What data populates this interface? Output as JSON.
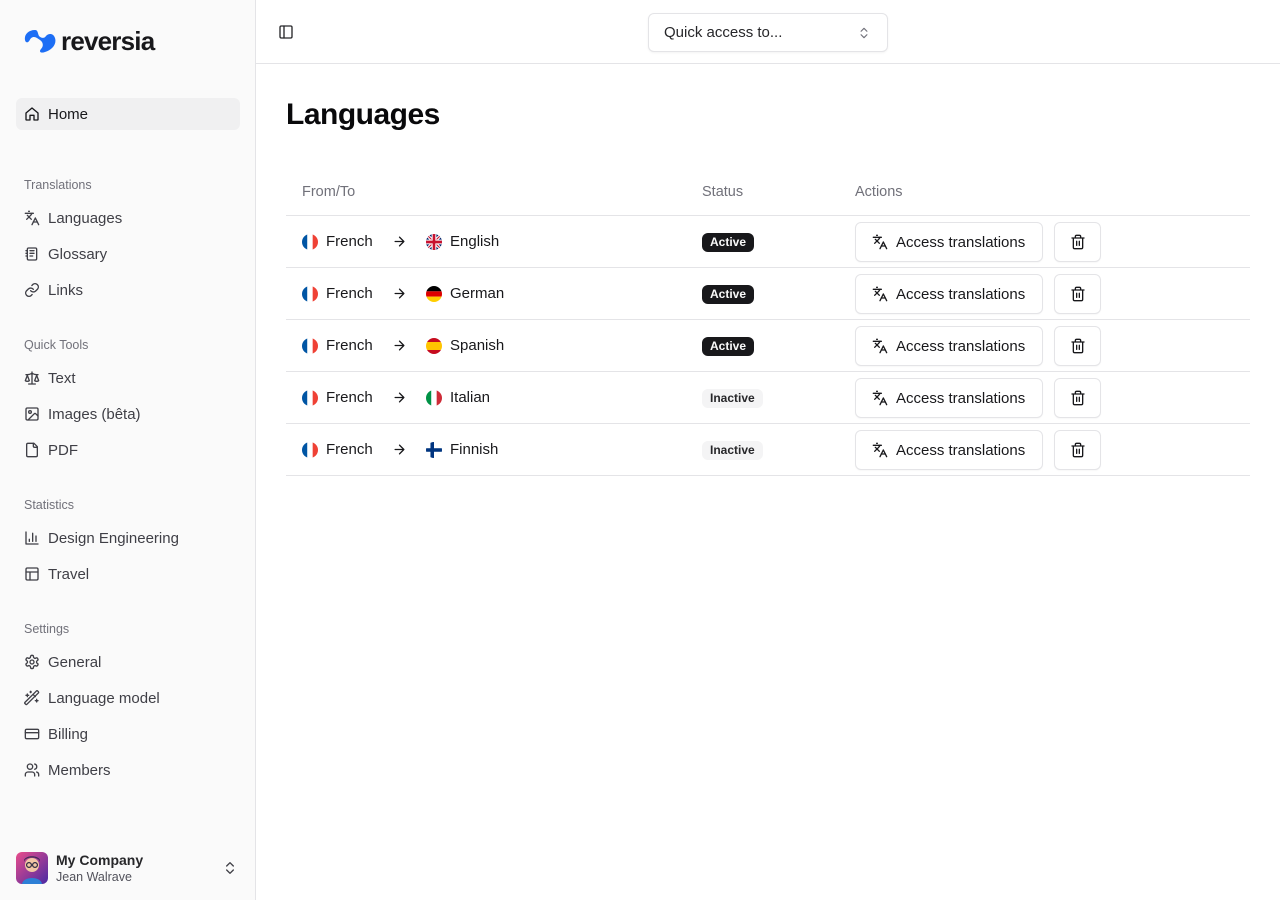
{
  "brand": {
    "name": "reversia",
    "accent": "#1d6ef5"
  },
  "sidebar": {
    "home": {
      "label": "Home",
      "icon": "home-icon"
    },
    "groups": [
      {
        "label": "Translations",
        "items": [
          {
            "label": "Languages",
            "icon": "translate-icon"
          },
          {
            "label": "Glossary",
            "icon": "notebook-icon"
          },
          {
            "label": "Links",
            "icon": "link-icon"
          }
        ]
      },
      {
        "label": "Quick Tools",
        "items": [
          {
            "label": "Text",
            "icon": "scale-icon"
          },
          {
            "label": "Images (bêta)",
            "icon": "image-icon"
          },
          {
            "label": "PDF",
            "icon": "file-icon"
          }
        ]
      },
      {
        "label": "Statistics",
        "items": [
          {
            "label": "Design Engineering",
            "icon": "bar-chart-icon"
          },
          {
            "label": "Travel",
            "icon": "table-icon"
          }
        ]
      },
      {
        "label": "Settings",
        "items": [
          {
            "label": "General",
            "icon": "gear-icon"
          },
          {
            "label": "Language model",
            "icon": "wand-icon"
          },
          {
            "label": "Billing",
            "icon": "credit-card-icon"
          },
          {
            "label": "Members",
            "icon": "users-icon"
          }
        ]
      }
    ],
    "user": {
      "company": "My Company",
      "name": "Jean Walrave"
    }
  },
  "topbar": {
    "quick_access": "Quick access to..."
  },
  "page": {
    "title": "Languages"
  },
  "table": {
    "headers": {
      "from_to": "From/To",
      "status": "Status",
      "actions": "Actions"
    },
    "action_label": "Access translations",
    "rows": [
      {
        "from": "French",
        "from_flag": "fr",
        "to": "English",
        "to_flag": "gb",
        "status": "Active"
      },
      {
        "from": "French",
        "from_flag": "fr",
        "to": "German",
        "to_flag": "de",
        "status": "Active"
      },
      {
        "from": "French",
        "from_flag": "fr",
        "to": "Spanish",
        "to_flag": "es",
        "status": "Active"
      },
      {
        "from": "French",
        "from_flag": "fr",
        "to": "Italian",
        "to_flag": "it",
        "status": "Inactive"
      },
      {
        "from": "French",
        "from_flag": "fr",
        "to": "Finnish",
        "to_flag": "fi",
        "status": "Inactive"
      }
    ]
  }
}
